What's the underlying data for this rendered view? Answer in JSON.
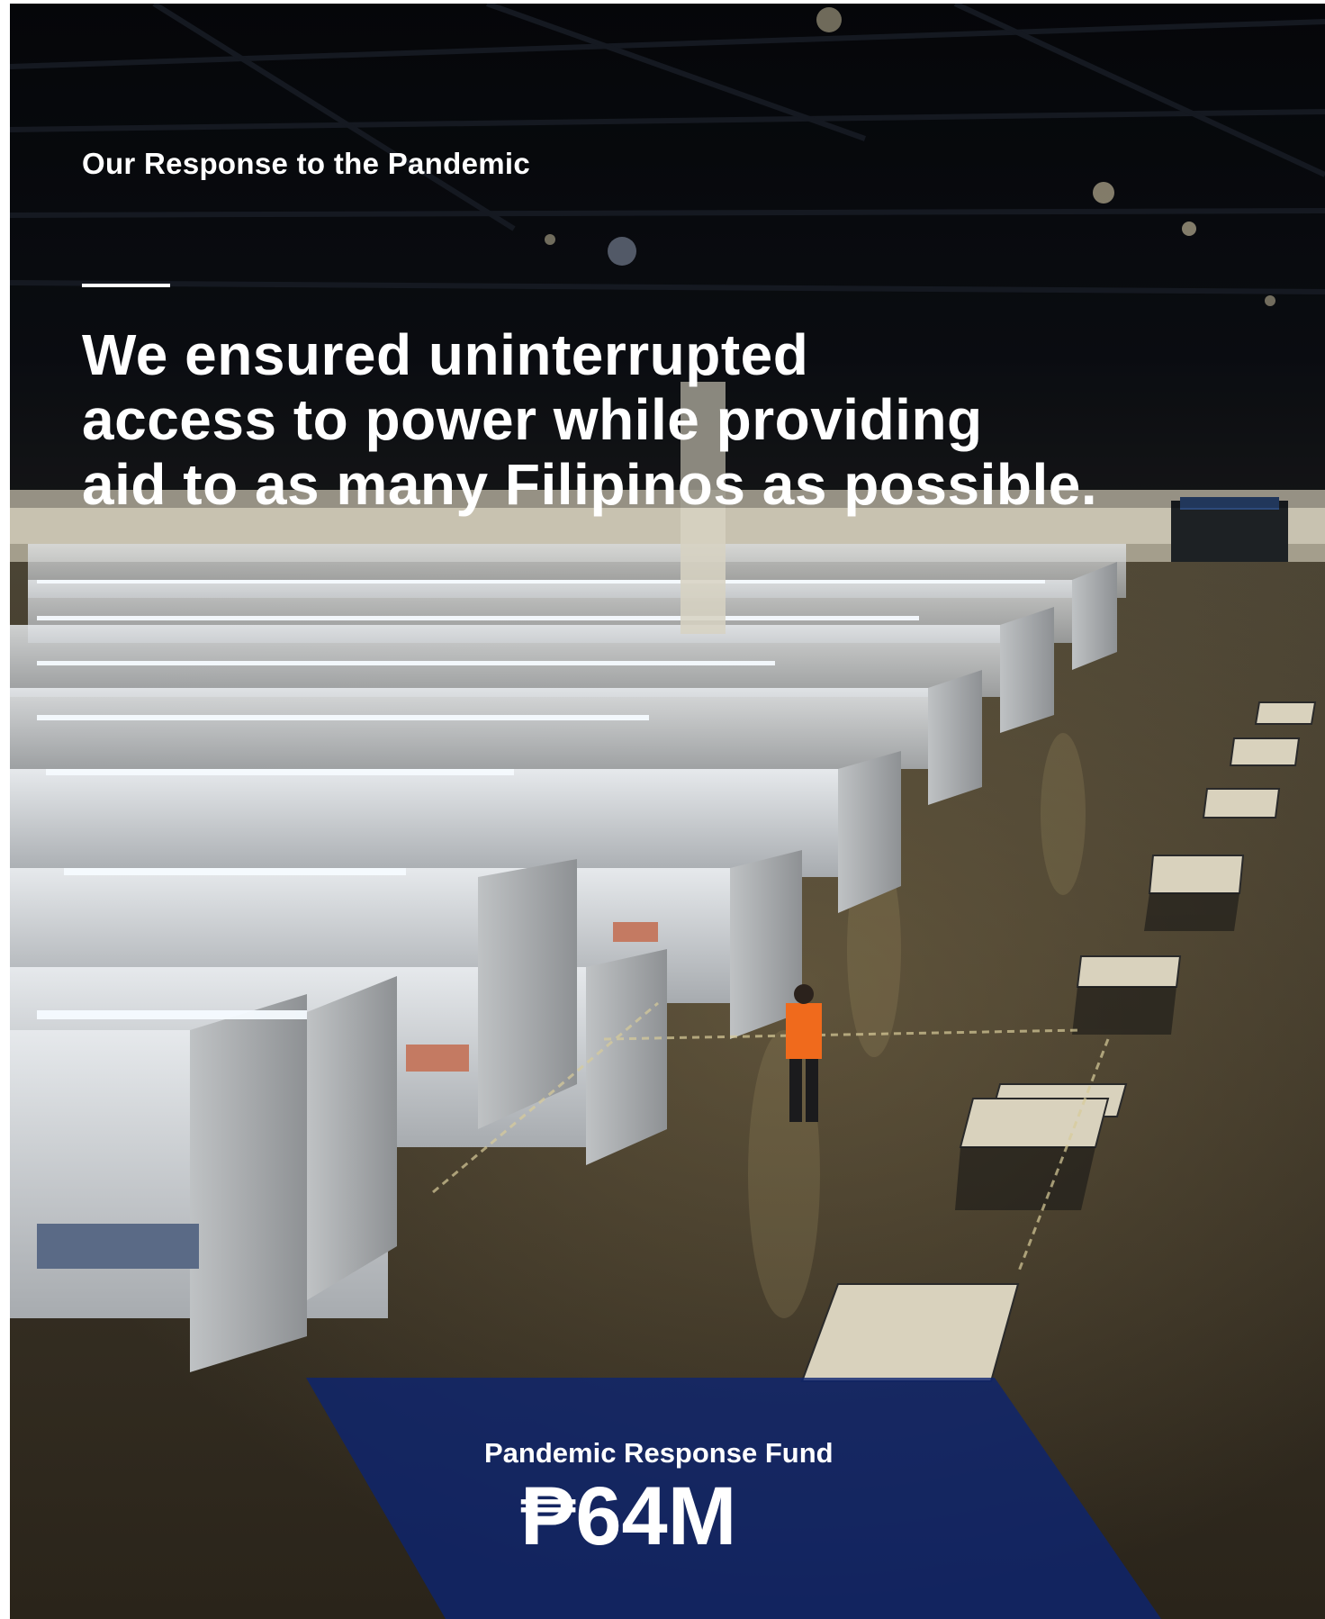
{
  "section": {
    "label": "Our Response to the Pandemic"
  },
  "headline": {
    "lines": [
      "We ensured uninterrupted",
      "access to power while providing",
      "aid to as many Filipinos as possible."
    ]
  },
  "fund": {
    "label": "Pandemic Response Fund",
    "value": "₱64M"
  },
  "colors": {
    "text": "#ffffff",
    "panel": "#0c2470"
  },
  "photo": {
    "description_icon": "isolation-facility-photo"
  }
}
